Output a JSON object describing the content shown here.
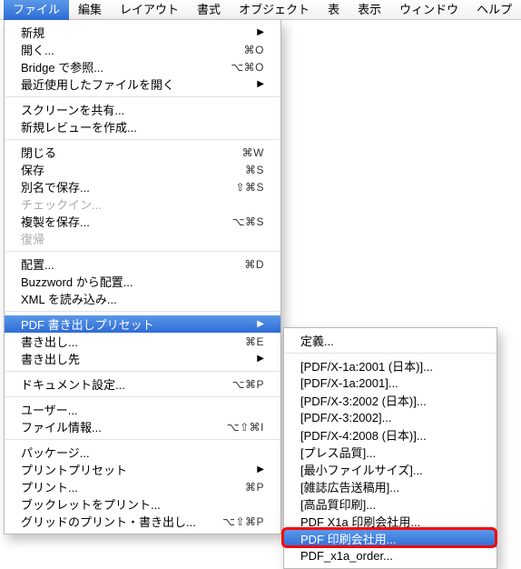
{
  "menubar": {
    "items": [
      "ファイル",
      "編集",
      "レイアウト",
      "書式",
      "オブジェクト",
      "表",
      "表示",
      "ウィンドウ",
      "ヘルプ"
    ],
    "active_index": 0
  },
  "dropdown": [
    {
      "label": "新規",
      "arrow": true
    },
    {
      "label": "開く...",
      "shortcut": "⌘O"
    },
    {
      "label": "Bridge で参照...",
      "shortcut": "⌥⌘O"
    },
    {
      "label": "最近使用したファイルを開く",
      "arrow": true
    },
    {
      "sep": true
    },
    {
      "label": "スクリーンを共有..."
    },
    {
      "label": "新規レビューを作成..."
    },
    {
      "sep": true
    },
    {
      "label": "閉じる",
      "shortcut": "⌘W"
    },
    {
      "label": "保存",
      "shortcut": "⌘S"
    },
    {
      "label": "別名で保存...",
      "shortcut": "⇧⌘S"
    },
    {
      "label": "チェックイン...",
      "disabled": true
    },
    {
      "label": "複製を保存...",
      "shortcut": "⌥⌘S"
    },
    {
      "label": "復帰",
      "disabled": true
    },
    {
      "sep": true
    },
    {
      "label": "配置...",
      "shortcut": "⌘D"
    },
    {
      "label": "Buzzword から配置..."
    },
    {
      "label": "XML を読み込み..."
    },
    {
      "sep": true
    },
    {
      "label": "PDF 書き出しプリセット",
      "arrow": true,
      "highlighted": true
    },
    {
      "label": "書き出し...",
      "shortcut": "⌘E"
    },
    {
      "label": "書き出し先",
      "arrow": true
    },
    {
      "sep": true
    },
    {
      "label": "ドキュメント設定...",
      "shortcut": "⌥⌘P"
    },
    {
      "sep": true
    },
    {
      "label": "ユーザー..."
    },
    {
      "label": "ファイル情報...",
      "shortcut": "⌥⇧⌘I"
    },
    {
      "sep": true
    },
    {
      "label": "パッケージ..."
    },
    {
      "label": "プリントプリセット",
      "arrow": true
    },
    {
      "label": "プリント...",
      "shortcut": "⌘P"
    },
    {
      "label": "ブックレットをプリント..."
    },
    {
      "label": "グリッドのプリント・書き出し...",
      "shortcut": "⌥⇧⌘P"
    }
  ],
  "submenu": [
    {
      "label": "定義..."
    },
    {
      "sep": true
    },
    {
      "label": "[PDF/X-1a:2001 (日本)]..."
    },
    {
      "label": "[PDF/X-1a:2001]..."
    },
    {
      "label": "[PDF/X-3:2002 (日本)]..."
    },
    {
      "label": "[PDF/X-3:2002]..."
    },
    {
      "label": "[PDF/X-4:2008 (日本)]..."
    },
    {
      "label": "[プレス品質]..."
    },
    {
      "label": "[最小ファイルサイズ]..."
    },
    {
      "label": "[雑誌広告送稿用]..."
    },
    {
      "label": "[高品質印刷]..."
    },
    {
      "label": "PDF X1a 印刷会社用..."
    },
    {
      "label": "PDF 印刷会社用...",
      "highlighted": true,
      "redbox": true
    },
    {
      "label": "PDF_x1a_order..."
    }
  ]
}
